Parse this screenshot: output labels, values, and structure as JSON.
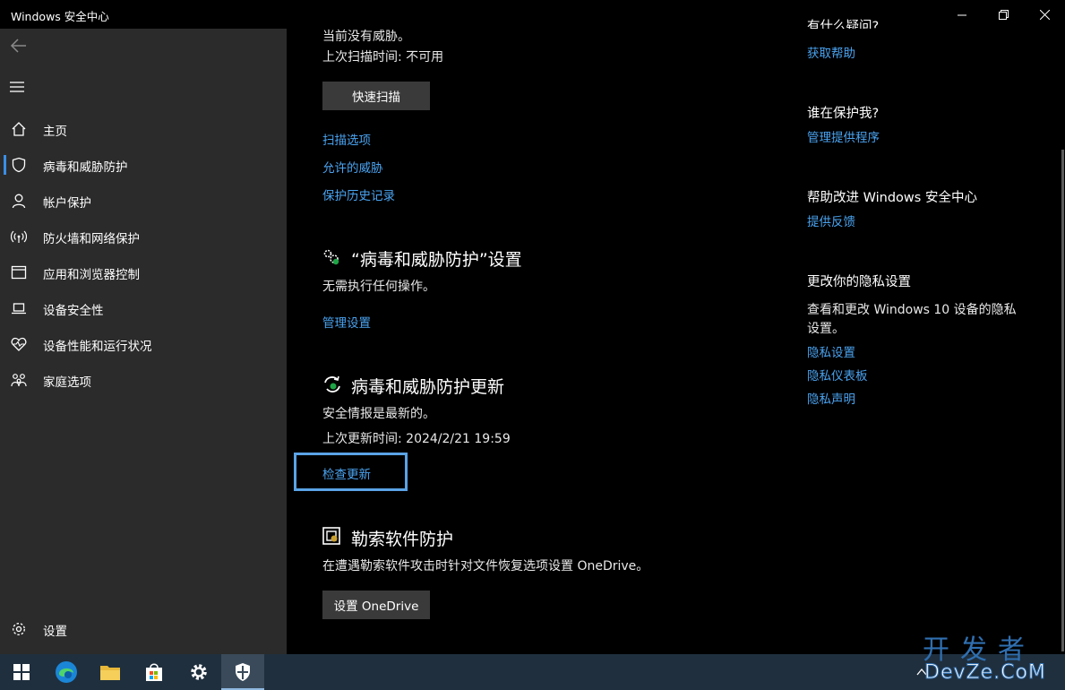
{
  "window": {
    "title": "Windows 安全中心"
  },
  "sidebar": {
    "items": [
      {
        "label": "主页",
        "icon": "home-icon"
      },
      {
        "label": "病毒和威胁防护",
        "icon": "shield-icon",
        "active": true
      },
      {
        "label": "帐户保护",
        "icon": "person-icon"
      },
      {
        "label": "防火墙和网络保护",
        "icon": "wifi-icon"
      },
      {
        "label": "应用和浏览器控制",
        "icon": "browser-window-icon"
      },
      {
        "label": "设备安全性",
        "icon": "laptop-icon"
      },
      {
        "label": "设备性能和运行状况",
        "icon": "heart-icon"
      },
      {
        "label": "家庭选项",
        "icon": "family-icon"
      }
    ],
    "settings_label": "设置"
  },
  "scan": {
    "no_threats": "当前没有威胁。",
    "last_scan": "上次扫描时间: 不可用",
    "quick_scan_button": "快速扫描",
    "links": [
      "扫描选项",
      "允许的威胁",
      "保护历史记录"
    ]
  },
  "settings_section": {
    "title": "“病毒和威胁防护”设置",
    "desc": "无需执行任何操作。",
    "link": "管理设置"
  },
  "update_section": {
    "title": "病毒和威胁防护更新",
    "status": "安全情报是最新的。",
    "last_update": "上次更新时间: 2024/2/21 19:59",
    "check_link": "检查更新"
  },
  "ransomware_section": {
    "title": "勒索软件防护",
    "desc": "在遭遇勒索软件攻击时针对文件恢复选项设置 OneDrive。",
    "button": "设置 OneDrive"
  },
  "right_panel": {
    "partial_heading": "有什么疑问?",
    "get_help": "获取帮助",
    "who_protects_heading": "谁在保护我?",
    "manage_providers": "管理提供程序",
    "improve_heading": "帮助改进 Windows 安全中心",
    "feedback": "提供反馈",
    "privacy_heading": "更改你的隐私设置",
    "privacy_desc_line1": "查看和更改 Windows 10 设备的隐私",
    "privacy_desc_line2": "设置。",
    "privacy_links": [
      "隐私设置",
      "隐私仪表板",
      "隐私声明"
    ]
  },
  "watermark": {
    "line1": "开发者",
    "line2": "DevZe.CoM"
  },
  "colors": {
    "accent": "#4aa3f0",
    "sidebar_bg": "#2b2b2b",
    "taskbar_bg": "#1f2f3e"
  }
}
